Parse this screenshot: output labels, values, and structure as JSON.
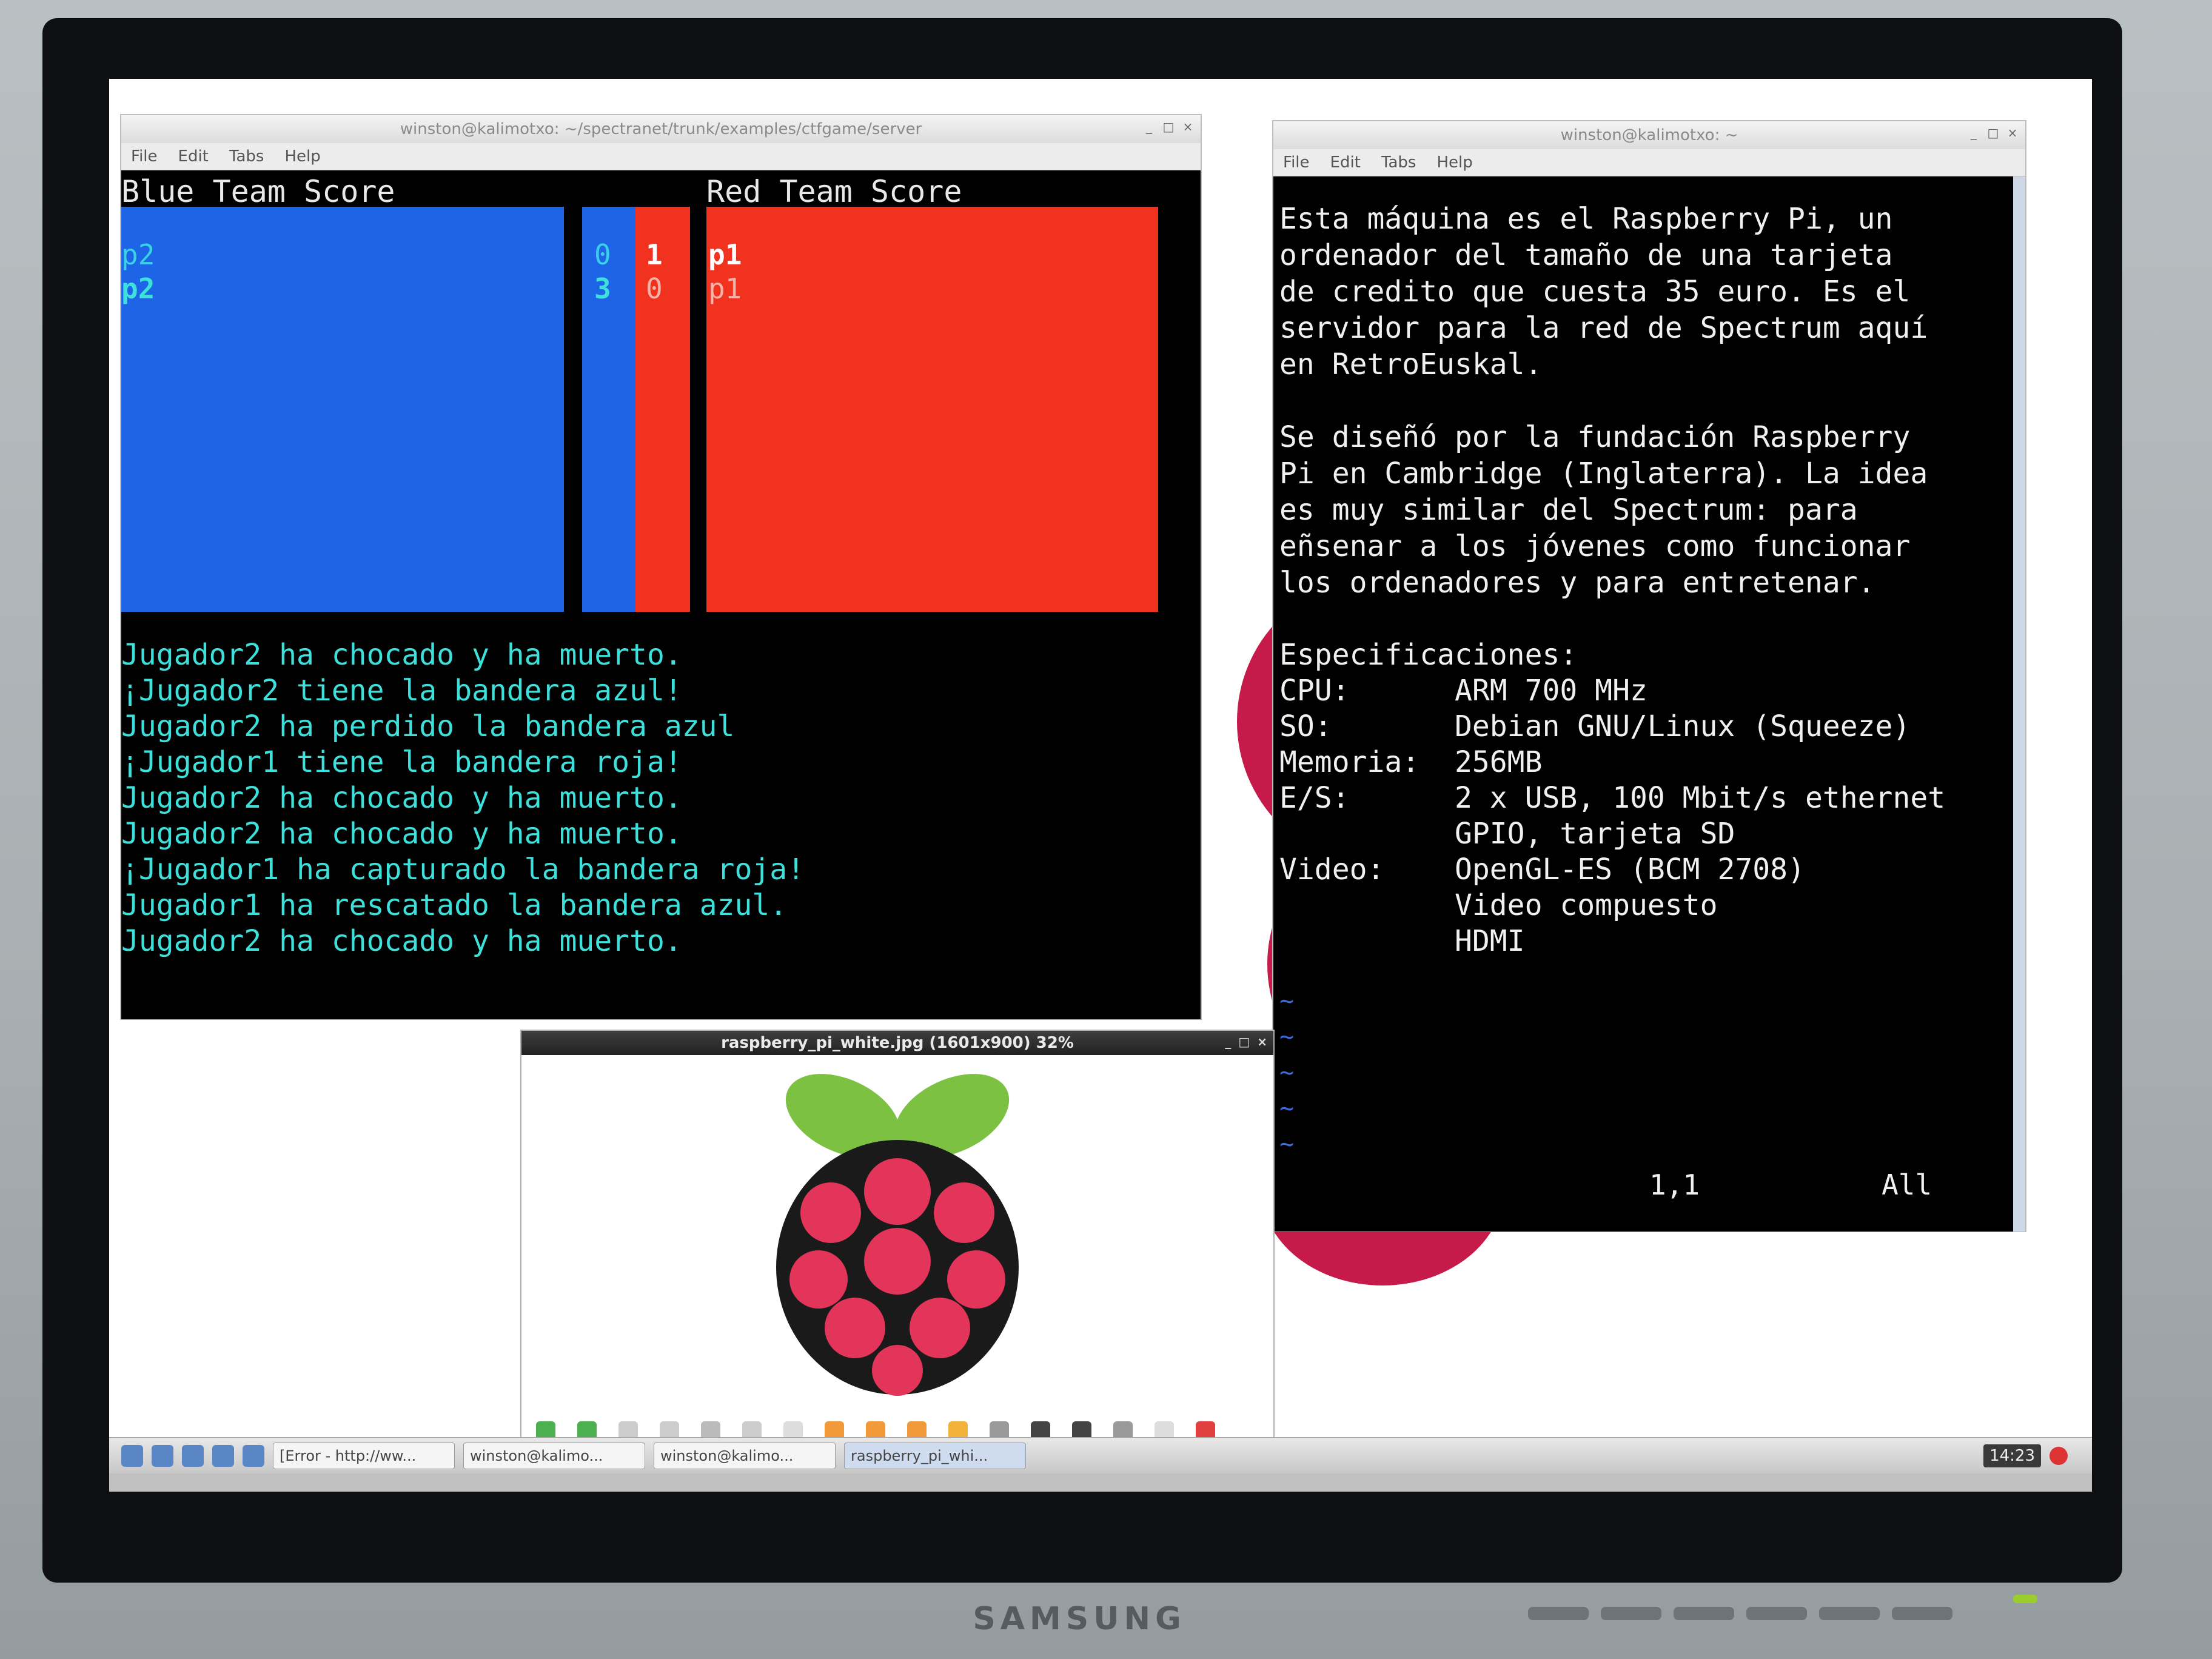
{
  "monitor": {
    "brand": "SAMSUNG"
  },
  "game_window": {
    "title": "winston@kalimotxo: ~/spectranet/trunk/examples/ctfgame/server",
    "menu": [
      "File",
      "Edit",
      "Tabs",
      "Help"
    ],
    "blue_header": "Blue Team Score",
    "red_header": "Red Team Score",
    "blue_rows": [
      {
        "name": "p2",
        "score": "0"
      },
      {
        "name": "p2",
        "score": "3"
      }
    ],
    "red_rows": [
      {
        "name": "p1",
        "score": "1"
      },
      {
        "name": "p1",
        "score": "0"
      }
    ],
    "log": [
      "Jugador2 ha chocado y ha muerto.",
      "¡Jugador2 tiene la bandera azul!",
      "Jugador2 ha perdido la bandera azul",
      "¡Jugador1 tiene la bandera roja!",
      "Jugador2 ha chocado y ha muerto.",
      "Jugador2 ha chocado y ha muerto.",
      "¡Jugador1 ha capturado la bandera roja!",
      "Jugador1 ha rescatado la bandera azul.",
      "Jugador2 ha chocado y ha muerto."
    ]
  },
  "info_window": {
    "title": "winston@kalimotxo: ~",
    "menu": [
      "File",
      "Edit",
      "Tabs",
      "Help"
    ],
    "para1": "Esta máquina es el Raspberry Pi, un\nordenador del tamaño de una tarjeta\nde credito que cuesta 35 euro. Es el\nservidor para la red de Spectrum aquí\nen RetroEuskal.",
    "para2": "Se diseñó por la fundación Raspberry\nPi en Cambridge (Inglaterra). La idea\nes muy similar del Spectrum: para\neñsenar a los jóvenes como funcionar\nlos ordenadores y para entretenar.",
    "specs_title": "Especificaciones:",
    "specs": [
      "CPU:      ARM 700 MHz",
      "SO:       Debian GNU/Linux (Squeeze)",
      "Memoria:  256MB",
      "E/S:      2 x USB, 100 Mbit/s ethernet",
      "          GPIO, tarjeta SD",
      "Video:    OpenGL-ES (BCM 2708)",
      "          Video compuesto",
      "          HDMI"
    ],
    "tilde_lines": [
      "~",
      "~",
      "~",
      "~",
      "~"
    ],
    "cursor_pos": "1,1",
    "view_pos": "All"
  },
  "viewer_window": {
    "title": "raspberry_pi_white.jpg (1601x900) 32%"
  },
  "taskbar": {
    "tasks": [
      "[Error - http://ww...",
      "winston@kalimo...",
      "winston@kalimo...",
      "raspberry_pi_whi..."
    ],
    "clock": "14:23"
  },
  "colors": {
    "blue_team": "#1d64e6",
    "red_team": "#f0321e",
    "log_text": "#3de0da",
    "vim_tilde": "#3d6bdb"
  }
}
